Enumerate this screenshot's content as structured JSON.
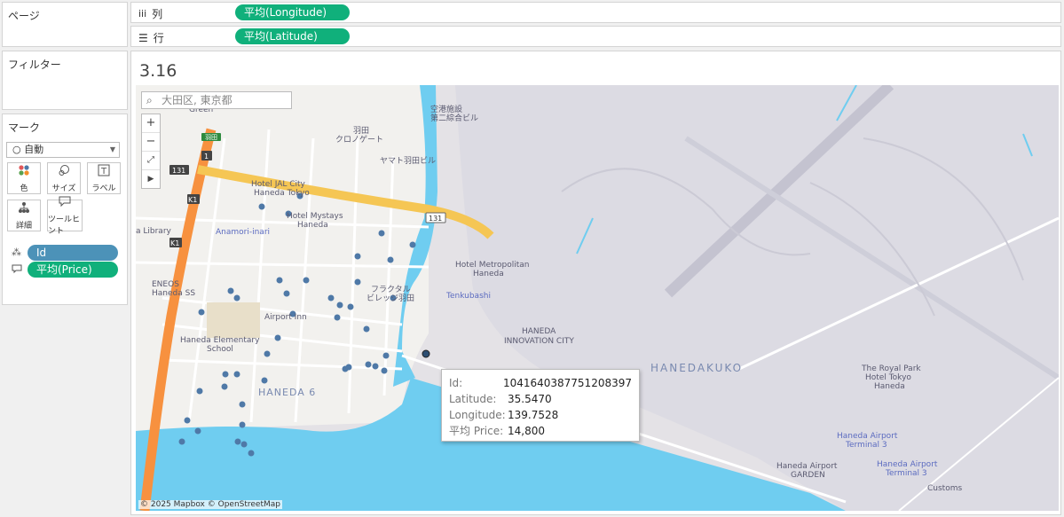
{
  "pages_panel": {
    "title": "ページ"
  },
  "filters_panel": {
    "title": "フィルター"
  },
  "columns_shelf": {
    "label": "列",
    "pill": "平均(Longitude)"
  },
  "rows_shelf": {
    "label": "行",
    "pill": "平均(Latitude)"
  },
  "marks_panel": {
    "title": "マーク",
    "mark_type": "自動",
    "buttons": [
      {
        "label": "色",
        "icon": "color-icon"
      },
      {
        "label": "サイズ",
        "icon": "size-icon"
      },
      {
        "label": "ラベル",
        "icon": "label-icon"
      },
      {
        "label": "詳細",
        "icon": "detail-icon"
      },
      {
        "label": "ツールヒント",
        "icon": "tooltip-icon"
      }
    ],
    "fields": [
      {
        "label": "Id",
        "icon": "detail-icon"
      },
      {
        "label": "平均(Price)",
        "icon": "tooltip-icon"
      }
    ]
  },
  "view": {
    "title": "3.16"
  },
  "map": {
    "search_placeholder": "大田区, 東京都",
    "attribution": "© 2025 Mapbox © OpenStreetMap",
    "labels": {
      "haneda6": "HANEDA 6",
      "hanedakuko": "HANEDAKUKO",
      "school": "Haneda Elementary School",
      "school_l1": "Haneda Elementary",
      "school_l2": "School",
      "hotel_jal1": "Hotel JAL City",
      "hotel_jal2": "Haneda Tokyo",
      "mystays1": "Hotel Mystays",
      "mystays2": "Haneda",
      "anamori": "Anamori-inari",
      "metropolitan1": "Hotel Metropolitan",
      "metropolitan2": "Haneda",
      "tenkubashi": "Tenkubashi",
      "innovation1": "HANEDA",
      "innovation2": "INNOVATION CITY",
      "royalpark1": "The Royal Park",
      "royalpark2": "Hotel Tokyo",
      "royalpark3": "Haneda",
      "t3a_1": "Haneda Airport",
      "t3a_2": "Terminal 3",
      "t3b_1": "Haneda Airport",
      "t3b_2": "Terminal 3",
      "garden1": "Haneda Airport",
      "garden2": "GARDEN",
      "customs": "Customs",
      "eneos1": "ENEOS",
      "eneos2": "Haneda SS",
      "library": "a Library",
      "airportin": "Airport Inn",
      "fractal1": "フラクタル",
      "fractal2": "ビレッジ羽田",
      "kuro1": "羽田",
      "kuro2": "クロノゲート",
      "yamato": "ヤマト羽田ビル",
      "kuko1": "空港施設",
      "kuko2": "第二綜合ビル",
      "green": "Green",
      "route131a": "131",
      "route131b": "131",
      "routek1a": "K1",
      "routek1b": "K1",
      "route1": "1",
      "haneda_sign": "羽田"
    }
  },
  "tooltip": {
    "rows": [
      {
        "key": "Id:",
        "value": "1041640387751208397"
      },
      {
        "key": "Latitude:",
        "value": "35.5470"
      },
      {
        "key": "Longitude:",
        "value": "139.7528"
      },
      {
        "key": "平均 Price:",
        "value": "14,800"
      }
    ]
  },
  "colors": {
    "pill_green": "#10b07b",
    "pill_blue": "#4c92b8",
    "mark": "#4f79a7",
    "water": "#6fcdf0",
    "highway": "#f7913f"
  }
}
